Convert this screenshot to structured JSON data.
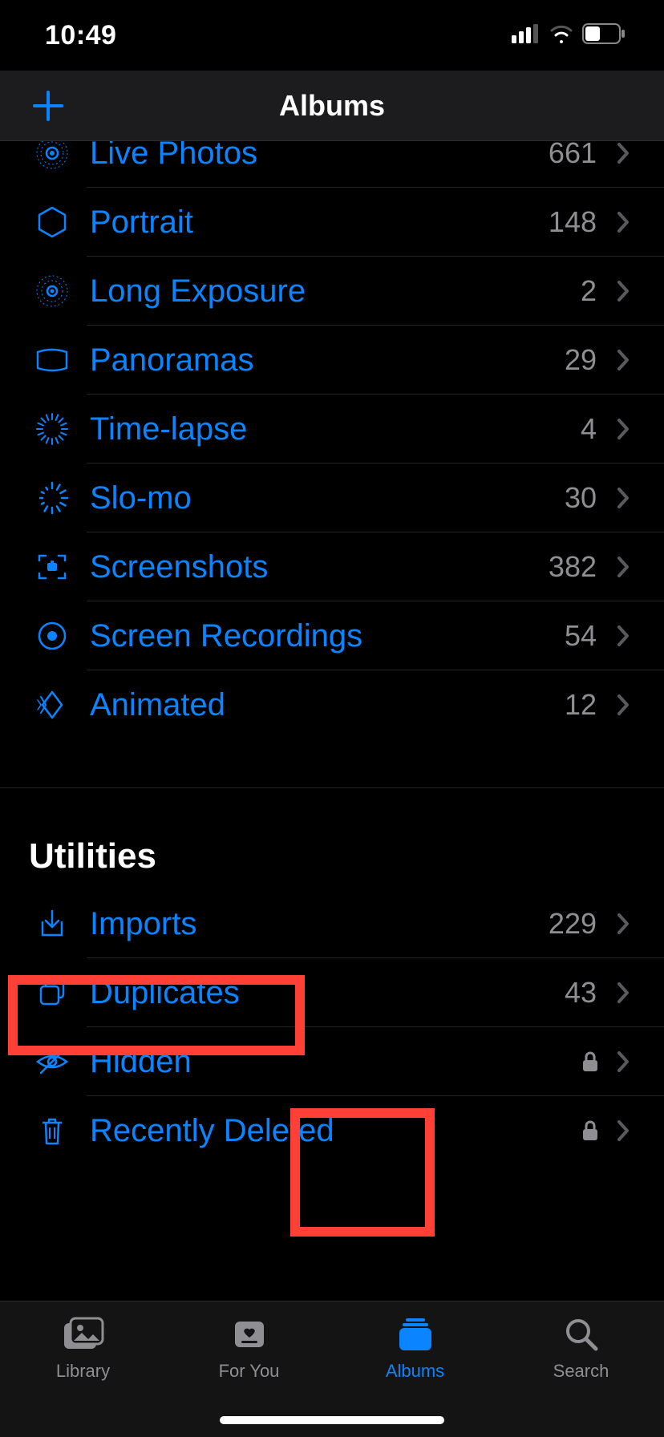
{
  "statusbar": {
    "time": "10:49"
  },
  "navbar": {
    "title": "Albums"
  },
  "media_types": [
    {
      "icon": "live-photos",
      "label": "Live Photos",
      "count": "661"
    },
    {
      "icon": "portrait",
      "label": "Portrait",
      "count": "148"
    },
    {
      "icon": "long-exposure",
      "label": "Long Exposure",
      "count": "2"
    },
    {
      "icon": "panoramas",
      "label": "Panoramas",
      "count": "29"
    },
    {
      "icon": "time-lapse",
      "label": "Time-lapse",
      "count": "4"
    },
    {
      "icon": "slo-mo",
      "label": "Slo-mo",
      "count": "30"
    },
    {
      "icon": "screenshots",
      "label": "Screenshots",
      "count": "382"
    },
    {
      "icon": "screen-record",
      "label": "Screen Recordings",
      "count": "54"
    },
    {
      "icon": "animated",
      "label": "Animated",
      "count": "12"
    }
  ],
  "utilities_header": "Utilities",
  "utilities": [
    {
      "icon": "imports",
      "label": "Imports",
      "count": "229",
      "locked": false
    },
    {
      "icon": "duplicates",
      "label": "Duplicates",
      "count": "43",
      "locked": false
    },
    {
      "icon": "hidden",
      "label": "Hidden",
      "count": "",
      "locked": true
    },
    {
      "icon": "trash",
      "label": "Recently Deleted",
      "count": "",
      "locked": true
    }
  ],
  "tabs": [
    {
      "id": "library",
      "label": "Library",
      "active": false
    },
    {
      "id": "foryou",
      "label": "For You",
      "active": false
    },
    {
      "id": "albums",
      "label": "Albums",
      "active": true
    },
    {
      "id": "search",
      "label": "Search",
      "active": false
    }
  ],
  "annotations": {
    "hidden_row_highlighted": true,
    "albums_tab_highlighted": true
  }
}
